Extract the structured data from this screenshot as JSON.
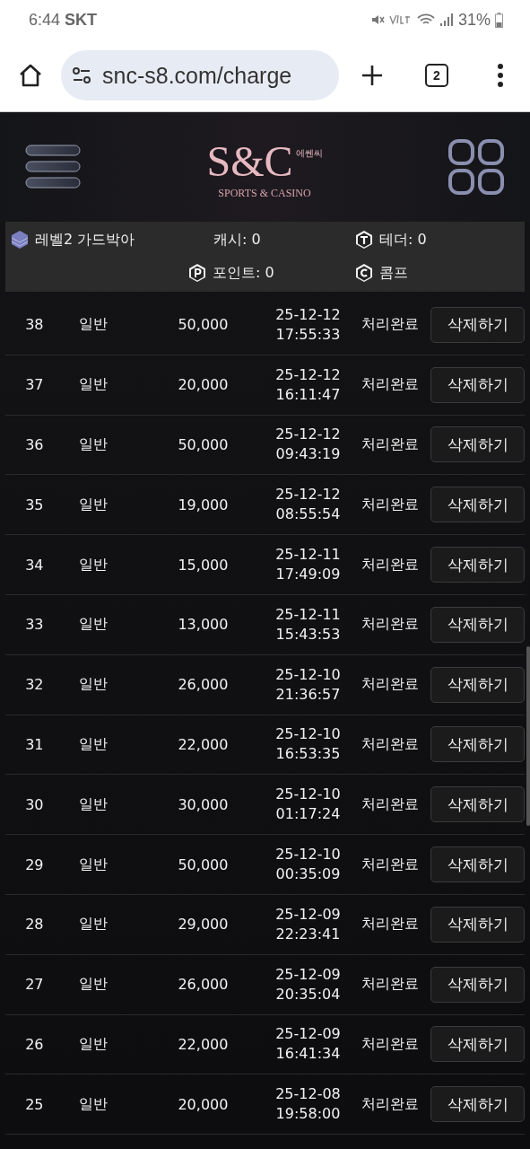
{
  "status_bar": {
    "time": "6:44",
    "carrier": "SKT",
    "battery": "31%"
  },
  "browser": {
    "url": "snc-s8.com/charge",
    "tab_count": "2"
  },
  "header": {
    "logo_korean": "에쎈씨",
    "logo_main": "S&C",
    "logo_tagline": "SPORTS & CASINO"
  },
  "account": {
    "level_name": "레벨2 가드박아",
    "cash": "캐시: 0",
    "tether": "테더: 0",
    "points": "포인트: 0",
    "comp": "콤프"
  },
  "rows": [
    {
      "id": "38",
      "type": "일반",
      "amount": "50,000",
      "date": "25-12-12",
      "time": "17:55:33",
      "status": "처리완료",
      "action": "삭제하기"
    },
    {
      "id": "37",
      "type": "일반",
      "amount": "20,000",
      "date": "25-12-12",
      "time": "16:11:47",
      "status": "처리완료",
      "action": "삭제하기"
    },
    {
      "id": "36",
      "type": "일반",
      "amount": "50,000",
      "date": "25-12-12",
      "time": "09:43:19",
      "status": "처리완료",
      "action": "삭제하기"
    },
    {
      "id": "35",
      "type": "일반",
      "amount": "19,000",
      "date": "25-12-12",
      "time": "08:55:54",
      "status": "처리완료",
      "action": "삭제하기"
    },
    {
      "id": "34",
      "type": "일반",
      "amount": "15,000",
      "date": "25-12-11",
      "time": "17:49:09",
      "status": "처리완료",
      "action": "삭제하기"
    },
    {
      "id": "33",
      "type": "일반",
      "amount": "13,000",
      "date": "25-12-11",
      "time": "15:43:53",
      "status": "처리완료",
      "action": "삭제하기"
    },
    {
      "id": "32",
      "type": "일반",
      "amount": "26,000",
      "date": "25-12-10",
      "time": "21:36:57",
      "status": "처리완료",
      "action": "삭제하기"
    },
    {
      "id": "31",
      "type": "일반",
      "amount": "22,000",
      "date": "25-12-10",
      "time": "16:53:35",
      "status": "처리완료",
      "action": "삭제하기"
    },
    {
      "id": "30",
      "type": "일반",
      "amount": "30,000",
      "date": "25-12-10",
      "time": "01:17:24",
      "status": "처리완료",
      "action": "삭제하기"
    },
    {
      "id": "29",
      "type": "일반",
      "amount": "50,000",
      "date": "25-12-10",
      "time": "00:35:09",
      "status": "처리완료",
      "action": "삭제하기"
    },
    {
      "id": "28",
      "type": "일반",
      "amount": "29,000",
      "date": "25-12-09",
      "time": "22:23:41",
      "status": "처리완료",
      "action": "삭제하기"
    },
    {
      "id": "27",
      "type": "일반",
      "amount": "26,000",
      "date": "25-12-09",
      "time": "20:35:04",
      "status": "처리완료",
      "action": "삭제하기"
    },
    {
      "id": "26",
      "type": "일반",
      "amount": "22,000",
      "date": "25-12-09",
      "time": "16:41:34",
      "status": "처리완료",
      "action": "삭제하기"
    },
    {
      "id": "25",
      "type": "일반",
      "amount": "20,000",
      "date": "25-12-08",
      "time": "19:58:00",
      "status": "처리완료",
      "action": "삭제하기"
    }
  ]
}
